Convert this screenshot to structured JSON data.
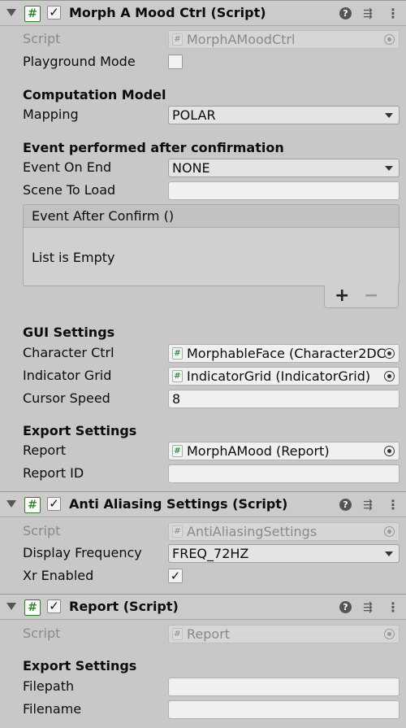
{
  "components": [
    {
      "title": "Morph A Mood Ctrl (Script)",
      "enabled": true,
      "script_label": "Script",
      "script_value": "MorphAMoodCtrl",
      "playground_label": "Playground Mode",
      "computation_header": "Computation Model",
      "mapping_label": "Mapping",
      "mapping_value": "POLAR",
      "event_header": "Event performed after confirmation",
      "event_on_end_label": "Event On End",
      "event_on_end_value": "NONE",
      "scene_to_load_label": "Scene To Load",
      "scene_to_load_value": "",
      "event_list_title": "Event After Confirm ()",
      "event_list_empty": "List is Empty",
      "list_add": "+",
      "list_remove": "−",
      "gui_header": "GUI Settings",
      "character_ctrl_label": "Character Ctrl",
      "character_ctrl_value": "MorphableFace (Character2DC",
      "indicator_grid_label": "Indicator Grid",
      "indicator_grid_value": "IndicatorGrid (IndicatorGrid)",
      "cursor_speed_label": "Cursor Speed",
      "cursor_speed_value": "8",
      "export_header": "Export Settings",
      "report_label": "Report",
      "report_value": "MorphAMood (Report)",
      "report_id_label": "Report ID",
      "report_id_value": ""
    },
    {
      "title": "Anti Aliasing Settings (Script)",
      "enabled": true,
      "script_label": "Script",
      "script_value": "AntiAliasingSettings",
      "display_frequency_label": "Display Frequency",
      "display_frequency_value": "FREQ_72HZ",
      "xr_enabled_label": "Xr Enabled",
      "xr_enabled": true
    },
    {
      "title": "Report (Script)",
      "enabled": true,
      "script_label": "Script",
      "script_value": "Report",
      "export_header": "Export Settings",
      "filepath_label": "Filepath",
      "filepath_value": "",
      "filename_label": "Filename",
      "filename_value": ""
    }
  ],
  "icons": {
    "fold": "triangle-down",
    "script": "#",
    "check": "✓",
    "help": "?",
    "presets": "⇶",
    "menu": "⋮"
  }
}
